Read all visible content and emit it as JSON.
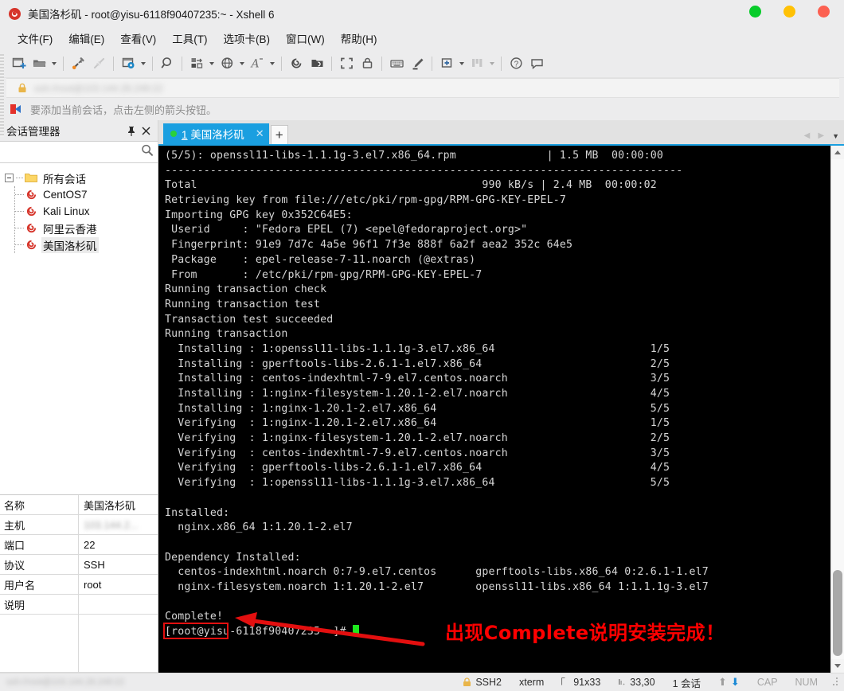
{
  "window": {
    "title": "美国洛杉矶 - root@yisu-6118f90407235:~ - Xshell 6",
    "logo_icon": "xshell-logo-icon",
    "controls": [
      {
        "name": "minimize-button",
        "color": "#08cc2a"
      },
      {
        "name": "maximize-button",
        "color": "#ffc105"
      },
      {
        "name": "close-button",
        "color": "#fc6051"
      }
    ]
  },
  "menubar": {
    "items": [
      {
        "label": "文件(F)",
        "name": "menu-file"
      },
      {
        "label": "编辑(E)",
        "name": "menu-edit"
      },
      {
        "label": "查看(V)",
        "name": "menu-view"
      },
      {
        "label": "工具(T)",
        "name": "menu-tools"
      },
      {
        "label": "选项卡(B)",
        "name": "menu-tabs"
      },
      {
        "label": "窗口(W)",
        "name": "menu-window"
      },
      {
        "label": "帮助(H)",
        "name": "menu-help"
      }
    ]
  },
  "toolbar": {
    "items": [
      {
        "icon": "new-session-icon",
        "caret": false
      },
      {
        "icon": "open-folder-icon",
        "caret": true
      },
      {
        "sep": true
      },
      {
        "icon": "connect-plug-icon",
        "caret": false
      },
      {
        "icon": "disconnect-plug-icon",
        "caret": false
      },
      {
        "sep": true
      },
      {
        "icon": "session-properties-icon",
        "caret": true
      },
      {
        "sep": true
      },
      {
        "icon": "find-icon",
        "caret": false
      },
      {
        "sep": true
      },
      {
        "icon": "layout-icon",
        "caret": true
      },
      {
        "icon": "globe-encoding-icon",
        "caret": true
      },
      {
        "icon": "font-size-icon",
        "caret": true
      },
      {
        "sep": true
      },
      {
        "icon": "xshell-spiral-icon",
        "caret": false
      },
      {
        "icon": "xftp-icon",
        "caret": false
      },
      {
        "sep": true
      },
      {
        "icon": "fullscreen-icon",
        "caret": false
      },
      {
        "icon": "lock-icon",
        "caret": false
      },
      {
        "sep": true
      },
      {
        "icon": "keyboard-icon",
        "caret": false
      },
      {
        "icon": "highlight-pen-icon",
        "caret": false
      },
      {
        "sep": true
      },
      {
        "icon": "add-to-folder-icon",
        "caret": true
      },
      {
        "icon": "columns-layout-icon",
        "caret": true
      },
      {
        "sep": true
      },
      {
        "icon": "help-icon",
        "caret": false
      },
      {
        "icon": "comment-icon",
        "caret": false
      }
    ]
  },
  "address_bar": {
    "lock_icon": "lock-icon",
    "value_redacted": "ssh://root@103.144.28.249:22"
  },
  "notice": {
    "icon": "add-session-arrow-icon",
    "text": "要添加当前会话，点击左侧的箭头按钮。"
  },
  "sidebar": {
    "title": "会话管理器",
    "pin_icon": "pin-icon",
    "close_icon": "close-icon",
    "search": {
      "value": "",
      "placeholder": "",
      "icon": "search-icon"
    },
    "tree": {
      "root_label": "所有会话",
      "root_icon": "folder-icon",
      "items": [
        {
          "label": "CentOS7",
          "icon": "session-icon",
          "selected": false
        },
        {
          "label": "Kali Linux",
          "icon": "session-icon",
          "selected": false
        },
        {
          "label": "阿里云香港",
          "icon": "session-icon",
          "selected": false
        },
        {
          "label": "美国洛杉矶",
          "icon": "session-icon",
          "selected": true
        }
      ]
    },
    "properties": [
      {
        "key": "名称",
        "value": "美国洛杉矶",
        "blurred": false
      },
      {
        "key": "主机",
        "value": "103.144.2...",
        "blurred": true
      },
      {
        "key": "端口",
        "value": "22",
        "blurred": false
      },
      {
        "key": "协议",
        "value": "SSH",
        "blurred": false
      },
      {
        "key": "用户名",
        "value": "root",
        "blurred": false
      },
      {
        "key": "说明",
        "value": "",
        "blurred": false
      }
    ]
  },
  "tabbar": {
    "tabs": [
      {
        "index": "1",
        "label": "美国洛杉矶",
        "active": true,
        "status_color": "#2ad13a",
        "close_icon": "close-icon"
      }
    ],
    "new_tab_icon": "plus-icon",
    "prev_icon": "chevron-left-icon",
    "next_icon": "chevron-right-icon",
    "list_icon": "chevron-down-icon"
  },
  "terminal": {
    "lines": [
      "(5/5): openssl11-libs-1.1.1g-3.el7.x86_64.rpm              | 1.5 MB  00:00:00",
      "--------------------------------------------------------------------------------",
      "Total                                            990 kB/s | 2.4 MB  00:00:02",
      "Retrieving key from file:///etc/pki/rpm-gpg/RPM-GPG-KEY-EPEL-7",
      "Importing GPG key 0x352C64E5:",
      " Userid     : \"Fedora EPEL (7) <epel@fedoraproject.org>\"",
      " Fingerprint: 91e9 7d7c 4a5e 96f1 7f3e 888f 6a2f aea2 352c 64e5",
      " Package    : epel-release-7-11.noarch (@extras)",
      " From       : /etc/pki/rpm-gpg/RPM-GPG-KEY-EPEL-7",
      "Running transaction check",
      "Running transaction test",
      "Transaction test succeeded",
      "Running transaction",
      "  Installing : 1:openssl11-libs-1.1.1g-3.el7.x86_64                        1/5",
      "  Installing : gperftools-libs-2.6.1-1.el7.x86_64                          2/5",
      "  Installing : centos-indexhtml-7-9.el7.centos.noarch                      3/5",
      "  Installing : 1:nginx-filesystem-1.20.1-2.el7.noarch                      4/5",
      "  Installing : 1:nginx-1.20.1-2.el7.x86_64                                 5/5",
      "  Verifying  : 1:nginx-1.20.1-2.el7.x86_64                                 1/5",
      "  Verifying  : 1:nginx-filesystem-1.20.1-2.el7.noarch                      2/5",
      "  Verifying  : centos-indexhtml-7-9.el7.centos.noarch                      3/5",
      "  Verifying  : gperftools-libs-2.6.1-1.el7.x86_64                          4/5",
      "  Verifying  : 1:openssl11-libs-1.1.1g-3.el7.x86_64                        5/5",
      "",
      "Installed:",
      "  nginx.x86_64 1:1.20.1-2.el7",
      "",
      "Dependency Installed:",
      "  centos-indexhtml.noarch 0:7-9.el7.centos      gperftools-libs.x86_64 0:2.6.1-1.el7",
      "  nginx-filesystem.noarch 1:1.20.1-2.el7        openssl11-libs.x86_64 1:1.1.1g-3.el7",
      "",
      "Complete!"
    ],
    "prompt": "[root@yisu-6118f90407235 ~]# ",
    "cursor": true
  },
  "annotation": {
    "box_target": "Complete!",
    "arrow_color": "#e30f0f",
    "text": "出现Complete说明安装完成！",
    "text_color": "#ff0000"
  },
  "statusbar": {
    "host_redacted": "ssh://root@103.144.28.249:22",
    "items": [
      {
        "label": "SSH2",
        "name": "status-protocol",
        "icon": "lock-icon"
      },
      {
        "label": "xterm",
        "name": "status-terminal-type",
        "icon": ""
      },
      {
        "label": "91x33",
        "name": "status-window-size",
        "icon": "resize-icon"
      },
      {
        "label": "33,30",
        "name": "status-cursor-position",
        "icon": "cursor-pos-icon"
      },
      {
        "label": "1 会话",
        "name": "status-session-count",
        "icon": ""
      }
    ],
    "transfer_up_icon": "arrow-up-icon",
    "transfer_down_icon": "arrow-down-icon",
    "cap_label": "CAP",
    "num_label": "NUM"
  }
}
